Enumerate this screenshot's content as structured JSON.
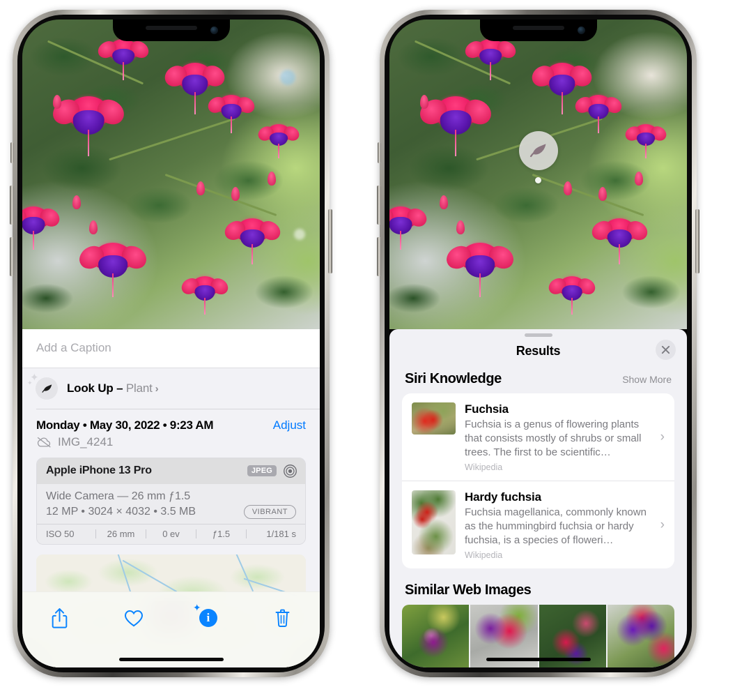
{
  "left_phone": {
    "caption": {
      "placeholder": "Add a Caption",
      "value": ""
    },
    "lookup": {
      "label": "Look Up – ",
      "subject": "Plant",
      "chevron": "›",
      "icon": "leaf-icon"
    },
    "date_line": "Monday • May 30, 2022 • 9:23 AM",
    "adjust_label": "Adjust",
    "file_name": "IMG_4241",
    "cloud_icon": "cloud-slash-icon",
    "metadata": {
      "device": "Apple iPhone 13 Pro",
      "format_tag": "JPEG",
      "aperture_icon": "aperture-icon",
      "lens": "Wide Camera — 26 mm ƒ1.5",
      "dimensions": "12 MP • 3024 × 4032 • 3.5 MB",
      "style_tag": "VIBRANT",
      "exif": [
        "ISO 50",
        "26 mm",
        "0 ev",
        "ƒ1.5",
        "1/181 s"
      ]
    },
    "toolbar": [
      {
        "name": "share-button",
        "icon": "share-icon"
      },
      {
        "name": "favorite-button",
        "icon": "heart-icon"
      },
      {
        "name": "info-button",
        "icon": "info-sparkle-icon",
        "glyph": "i"
      },
      {
        "name": "delete-button",
        "icon": "trash-icon"
      }
    ]
  },
  "right_phone": {
    "lookup_badge": {
      "icon": "leaf-icon"
    },
    "sheet": {
      "title": "Results",
      "close_icon": "close-icon",
      "grabber": "grabber-handle"
    },
    "siri_knowledge": {
      "heading": "Siri Knowledge",
      "show_more": "Show More",
      "cards": [
        {
          "title": "Fuchsia",
          "description": "Fuchsia is a genus of flowering plants that consists mostly of shrubs or small trees. The first to be scientific…",
          "source": "Wikipedia",
          "chevron": "›"
        },
        {
          "title": "Hardy fuchsia",
          "description": "Fuchsia magellanica, commonly known as the hummingbird fuchsia or hardy fuchsia, is a species of floweri…",
          "source": "Wikipedia",
          "chevron": "›"
        }
      ]
    },
    "similar_web_images": {
      "heading": "Similar Web Images",
      "thumbnails": [
        "fuchsia-thumb-1",
        "fuchsia-thumb-2",
        "fuchsia-thumb-3",
        "fuchsia-thumb-4"
      ]
    }
  },
  "colors": {
    "accent_blue": "#007aff",
    "info_blue": "#0a84ff",
    "sheet_bg": "#f1f1f5",
    "card_bg": "#ffffff",
    "secondary_text": "#8e8e93"
  }
}
